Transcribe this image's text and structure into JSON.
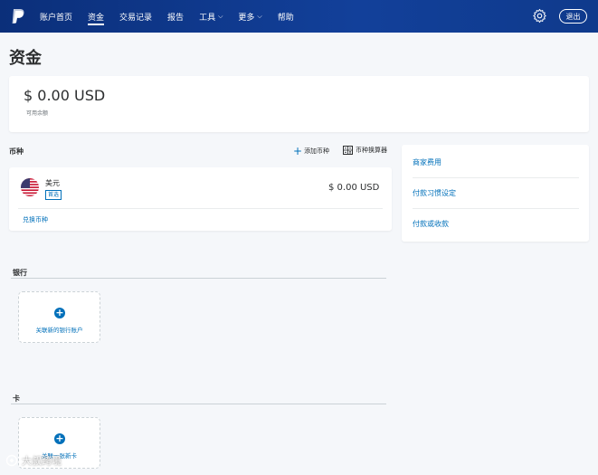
{
  "nav": {
    "items": [
      {
        "label": "账户首页",
        "active": false,
        "has_dropdown": false
      },
      {
        "label": "资金",
        "active": true,
        "has_dropdown": false
      },
      {
        "label": "交易记录",
        "active": false,
        "has_dropdown": false
      },
      {
        "label": "报告",
        "active": false,
        "has_dropdown": false
      },
      {
        "label": "工具",
        "active": false,
        "has_dropdown": true
      },
      {
        "label": "更多",
        "active": false,
        "has_dropdown": true
      },
      {
        "label": "帮助",
        "active": false,
        "has_dropdown": false
      }
    ],
    "logout_label": "退出",
    "icons": {
      "logo": "paypal-logo-icon",
      "settings": "gear-icon",
      "dropdown": "chevron-down-icon"
    }
  },
  "page": {
    "title": "资金"
  },
  "balance": {
    "amount": "$ 0.00 USD",
    "label": "可用余额"
  },
  "currency": {
    "heading": "币种",
    "add_label": "添加币种",
    "converter_label": "币种换算器",
    "items": [
      {
        "name": "美元",
        "badge": "首选",
        "amount": "$ 0.00 USD",
        "flag": "us-flag-icon"
      }
    ],
    "convert_link": "兑换币种"
  },
  "side_links": [
    "商家费用",
    "付款习惯设定",
    "付款或收款"
  ],
  "bank": {
    "heading": "银行",
    "link_label": "关联新的银行账户"
  },
  "card": {
    "heading": "卡",
    "link_label": "关联一张新卡"
  },
  "watermark": {
    "text": "大叔跨境"
  },
  "colors": {
    "nav_bg": "#0f3a8c",
    "link": "#0070ba",
    "page_bg": "#f5f7fa"
  }
}
